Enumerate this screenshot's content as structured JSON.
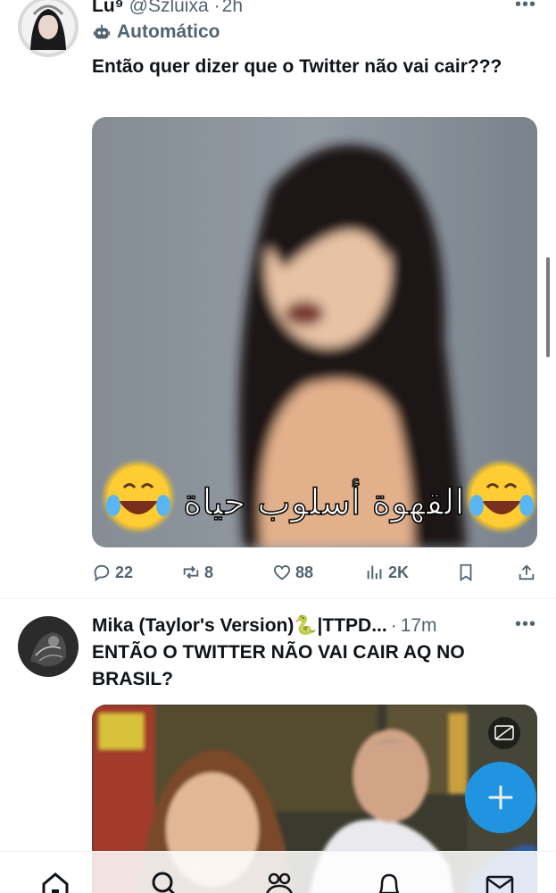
{
  "tweets": [
    {
      "display_name": "Lu⁹",
      "handle": "@Szluixa",
      "time": "2h",
      "automated_label": "Automático",
      "text": "Então quer dizer que o Twitter não vai cair???",
      "media_caption": "القهوة أسلوب حياة",
      "actions": {
        "replies": "22",
        "retweets": "8",
        "likes": "88",
        "views": "2K"
      }
    },
    {
      "display_name": "Mika (Taylor's Version)🐍|TTPD...",
      "time": "17m",
      "text": "ENTÃO O TWITTER NÃO VAI CAIR AQ NO BRASIL?"
    }
  ],
  "more_glyph": "•••",
  "colors": {
    "accent": "#1d9bf0",
    "text": "#0f1419",
    "muted": "#536471"
  },
  "icons": [
    "reply-icon",
    "retweet-icon",
    "heart-icon",
    "views-icon",
    "bookmark-icon",
    "share-icon",
    "robot-icon",
    "compose-icon",
    "home-icon",
    "search-icon",
    "communities-icon",
    "notifications-icon",
    "messages-icon"
  ]
}
